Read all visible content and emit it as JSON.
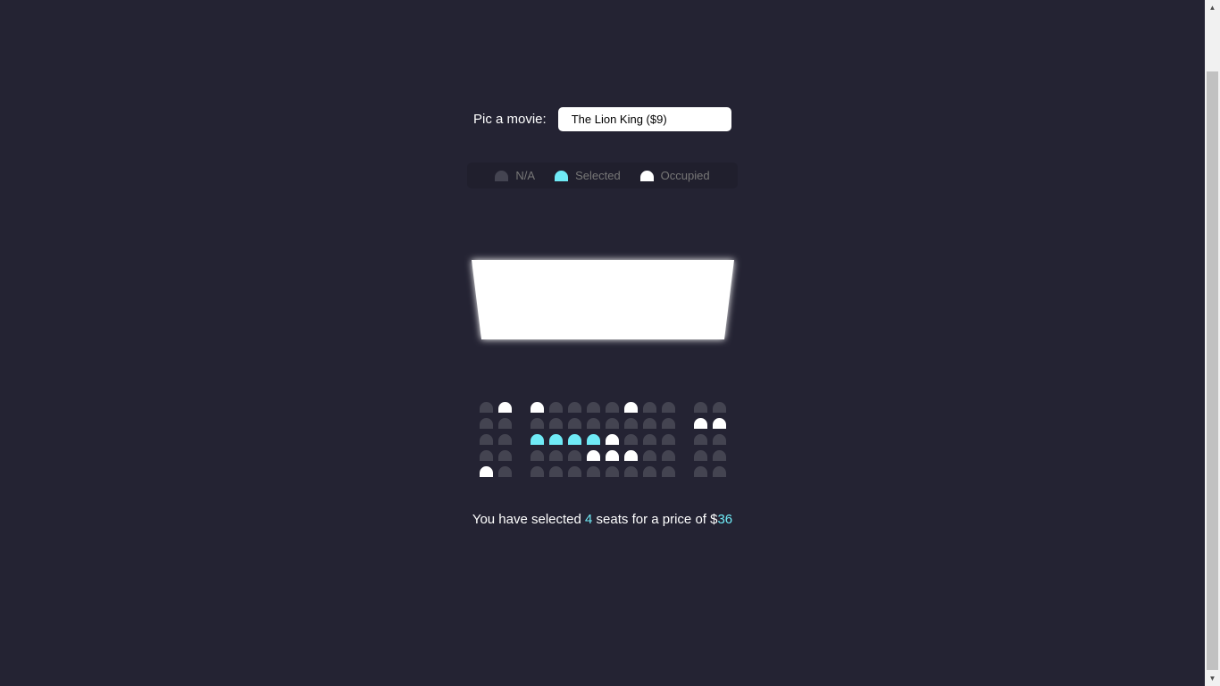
{
  "movie_picker": {
    "label": "Pic a movie:",
    "selected": "The Lion King ($9)"
  },
  "legend": [
    {
      "label": "N/A",
      "state": "na"
    },
    {
      "label": "Selected",
      "state": "selected"
    },
    {
      "label": "Occupied",
      "state": "occupied"
    }
  ],
  "colors": {
    "background": "#242333",
    "seat_na": "#444451",
    "seat_selected": "#6feaf6",
    "seat_occupied": "#ffffff"
  },
  "seating": {
    "rows": [
      [
        "na",
        "occupied",
        "occupied",
        "na",
        "na",
        "na",
        "na",
        "occupied",
        "na",
        "na",
        "na",
        "na"
      ],
      [
        "na",
        "na",
        "na",
        "na",
        "na",
        "na",
        "na",
        "na",
        "na",
        "na",
        "occupied",
        "occupied"
      ],
      [
        "na",
        "na",
        "selected",
        "selected",
        "selected",
        "selected",
        "occupied",
        "na",
        "na",
        "na",
        "na",
        "na"
      ],
      [
        "na",
        "na",
        "na",
        "na",
        "na",
        "occupied",
        "occupied",
        "occupied",
        "na",
        "na",
        "na",
        "na"
      ],
      [
        "occupied",
        "na",
        "na",
        "na",
        "na",
        "na",
        "na",
        "na",
        "na",
        "na",
        "na",
        "na"
      ]
    ]
  },
  "summary": {
    "prefix": "You have selected ",
    "count": "4",
    "middle": " seats for a price of $",
    "total": "36"
  }
}
